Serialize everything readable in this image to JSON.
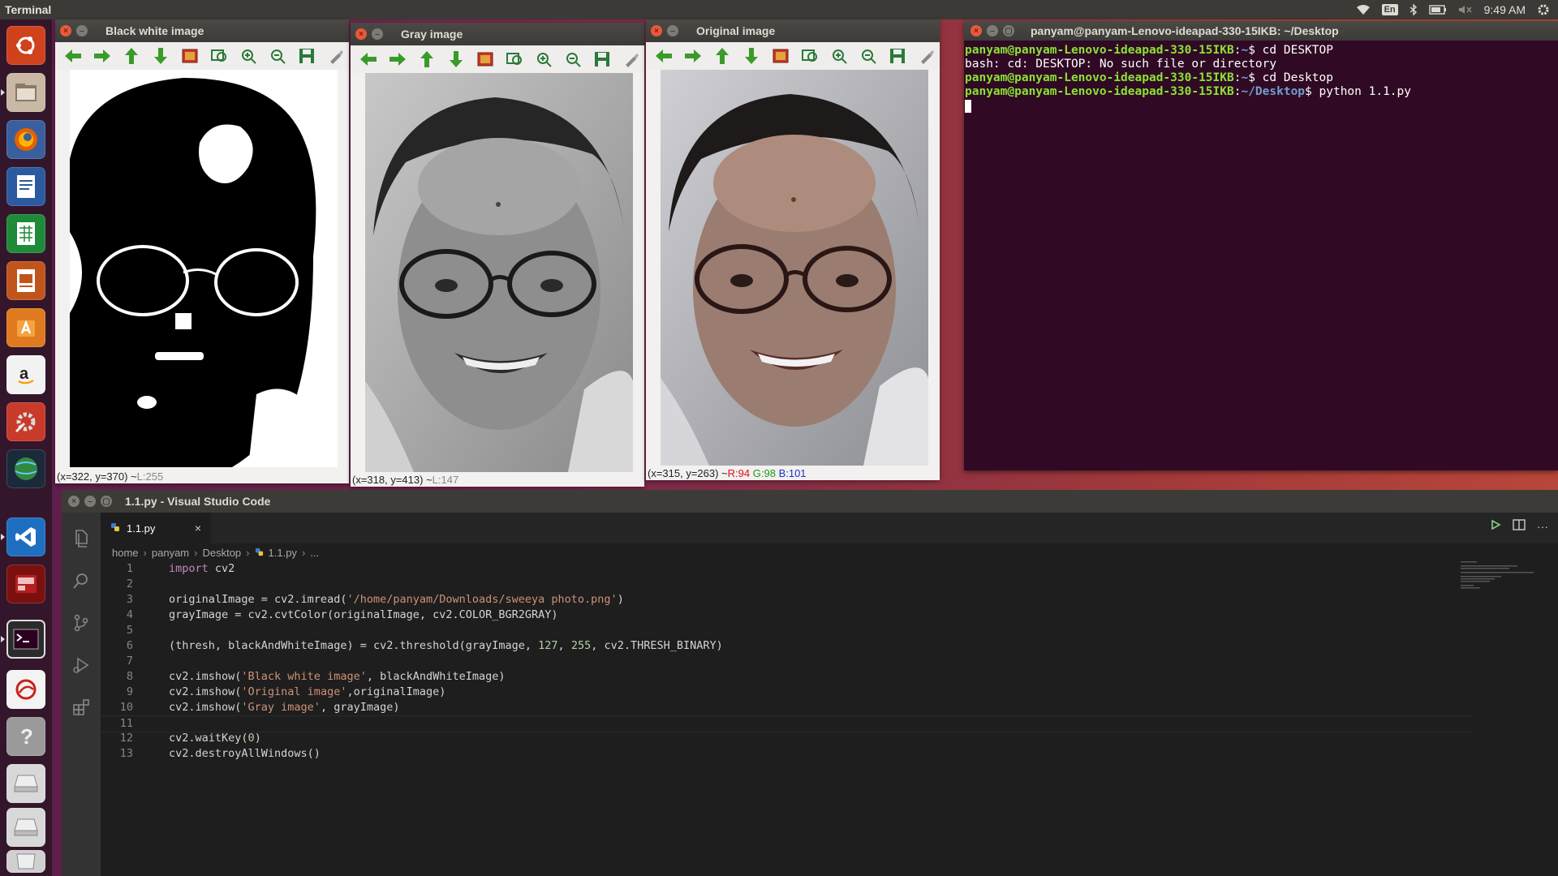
{
  "topbar": {
    "app_title": "Terminal",
    "keyboard": "En",
    "time": "9:49 AM"
  },
  "colors": {
    "terminal_bg": "#300a24",
    "prompt_user": "#8ae234",
    "prompt_path": "#729fcf",
    "vscode_bg": "#1e1e1e",
    "close_button": "#e8593b"
  },
  "launcher": {
    "items": [
      {
        "icon": "ubuntu-dash-icon"
      },
      {
        "icon": "files-icon"
      },
      {
        "icon": "firefox-icon"
      },
      {
        "icon": "libreoffice-writer-icon"
      },
      {
        "icon": "libreoffice-calc-icon"
      },
      {
        "icon": "libreoffice-impress-icon"
      },
      {
        "icon": "software-center-icon"
      },
      {
        "icon": "amazon-icon"
      },
      {
        "icon": "system-settings-icon"
      },
      {
        "icon": "globe-icon"
      },
      {
        "icon": "vscode-icon"
      },
      {
        "icon": "app-red-icon"
      },
      {
        "icon": "terminal-icon"
      },
      {
        "icon": "app-swirl-icon"
      },
      {
        "icon": "help-icon"
      },
      {
        "icon": "drive-icon"
      },
      {
        "icon": "drive-2-icon"
      },
      {
        "icon": "trash-icon"
      }
    ]
  },
  "windows": {
    "bw": {
      "title": "Black white image",
      "status_coords": "(x=322, y=370) ~ ",
      "status_value": "L:255"
    },
    "gray": {
      "title": "Gray image",
      "status_coords": "(x=318, y=413) ~ ",
      "status_value": "L:147"
    },
    "original": {
      "title": "Original image",
      "status_coords": "(x=315, y=263) ~ ",
      "r": "R:94",
      "g": "G:98",
      "b": "B:101"
    }
  },
  "terminal": {
    "title": "panyam@panyam-Lenovo-ideapad-330-15IKB: ~/Desktop",
    "lines": [
      {
        "user": "panyam@panyam-Lenovo-ideapad-330-15IKB",
        "path": "~",
        "cmd": " cd DESKTOP"
      },
      {
        "text": "bash: cd: DESKTOP: No such file or directory"
      },
      {
        "user": "panyam@panyam-Lenovo-ideapad-330-15IKB",
        "path": "~",
        "cmd": " cd Desktop"
      },
      {
        "user": "panyam@panyam-Lenovo-ideapad-330-15IKB",
        "path": "~/Desktop",
        "cmd": " python 1.1.py"
      }
    ]
  },
  "vscode": {
    "title": "1.1.py - Visual Studio Code",
    "tab": "1.1.py",
    "breadcrumb": [
      "home",
      "panyam",
      "Desktop",
      "1.1.py",
      "..."
    ],
    "code": [
      "import cv2",
      "",
      "originalImage = cv2.imread('/home/panyam/Downloads/sweeya photo.png')",
      "grayImage = cv2.cvtColor(originalImage, cv2.COLOR_BGR2GRAY)",
      "",
      "(thresh, blackAndWhiteImage) = cv2.threshold(grayImage, 127, 255, cv2.THRESH_BINARY)",
      "",
      "cv2.imshow('Black white image', blackAndWhiteImage)",
      "cv2.imshow('Original image',originalImage)",
      "cv2.imshow('Gray image', grayImage)",
      "",
      "cv2.waitKey(0)",
      "cv2.destroyAllWindows()"
    ]
  }
}
